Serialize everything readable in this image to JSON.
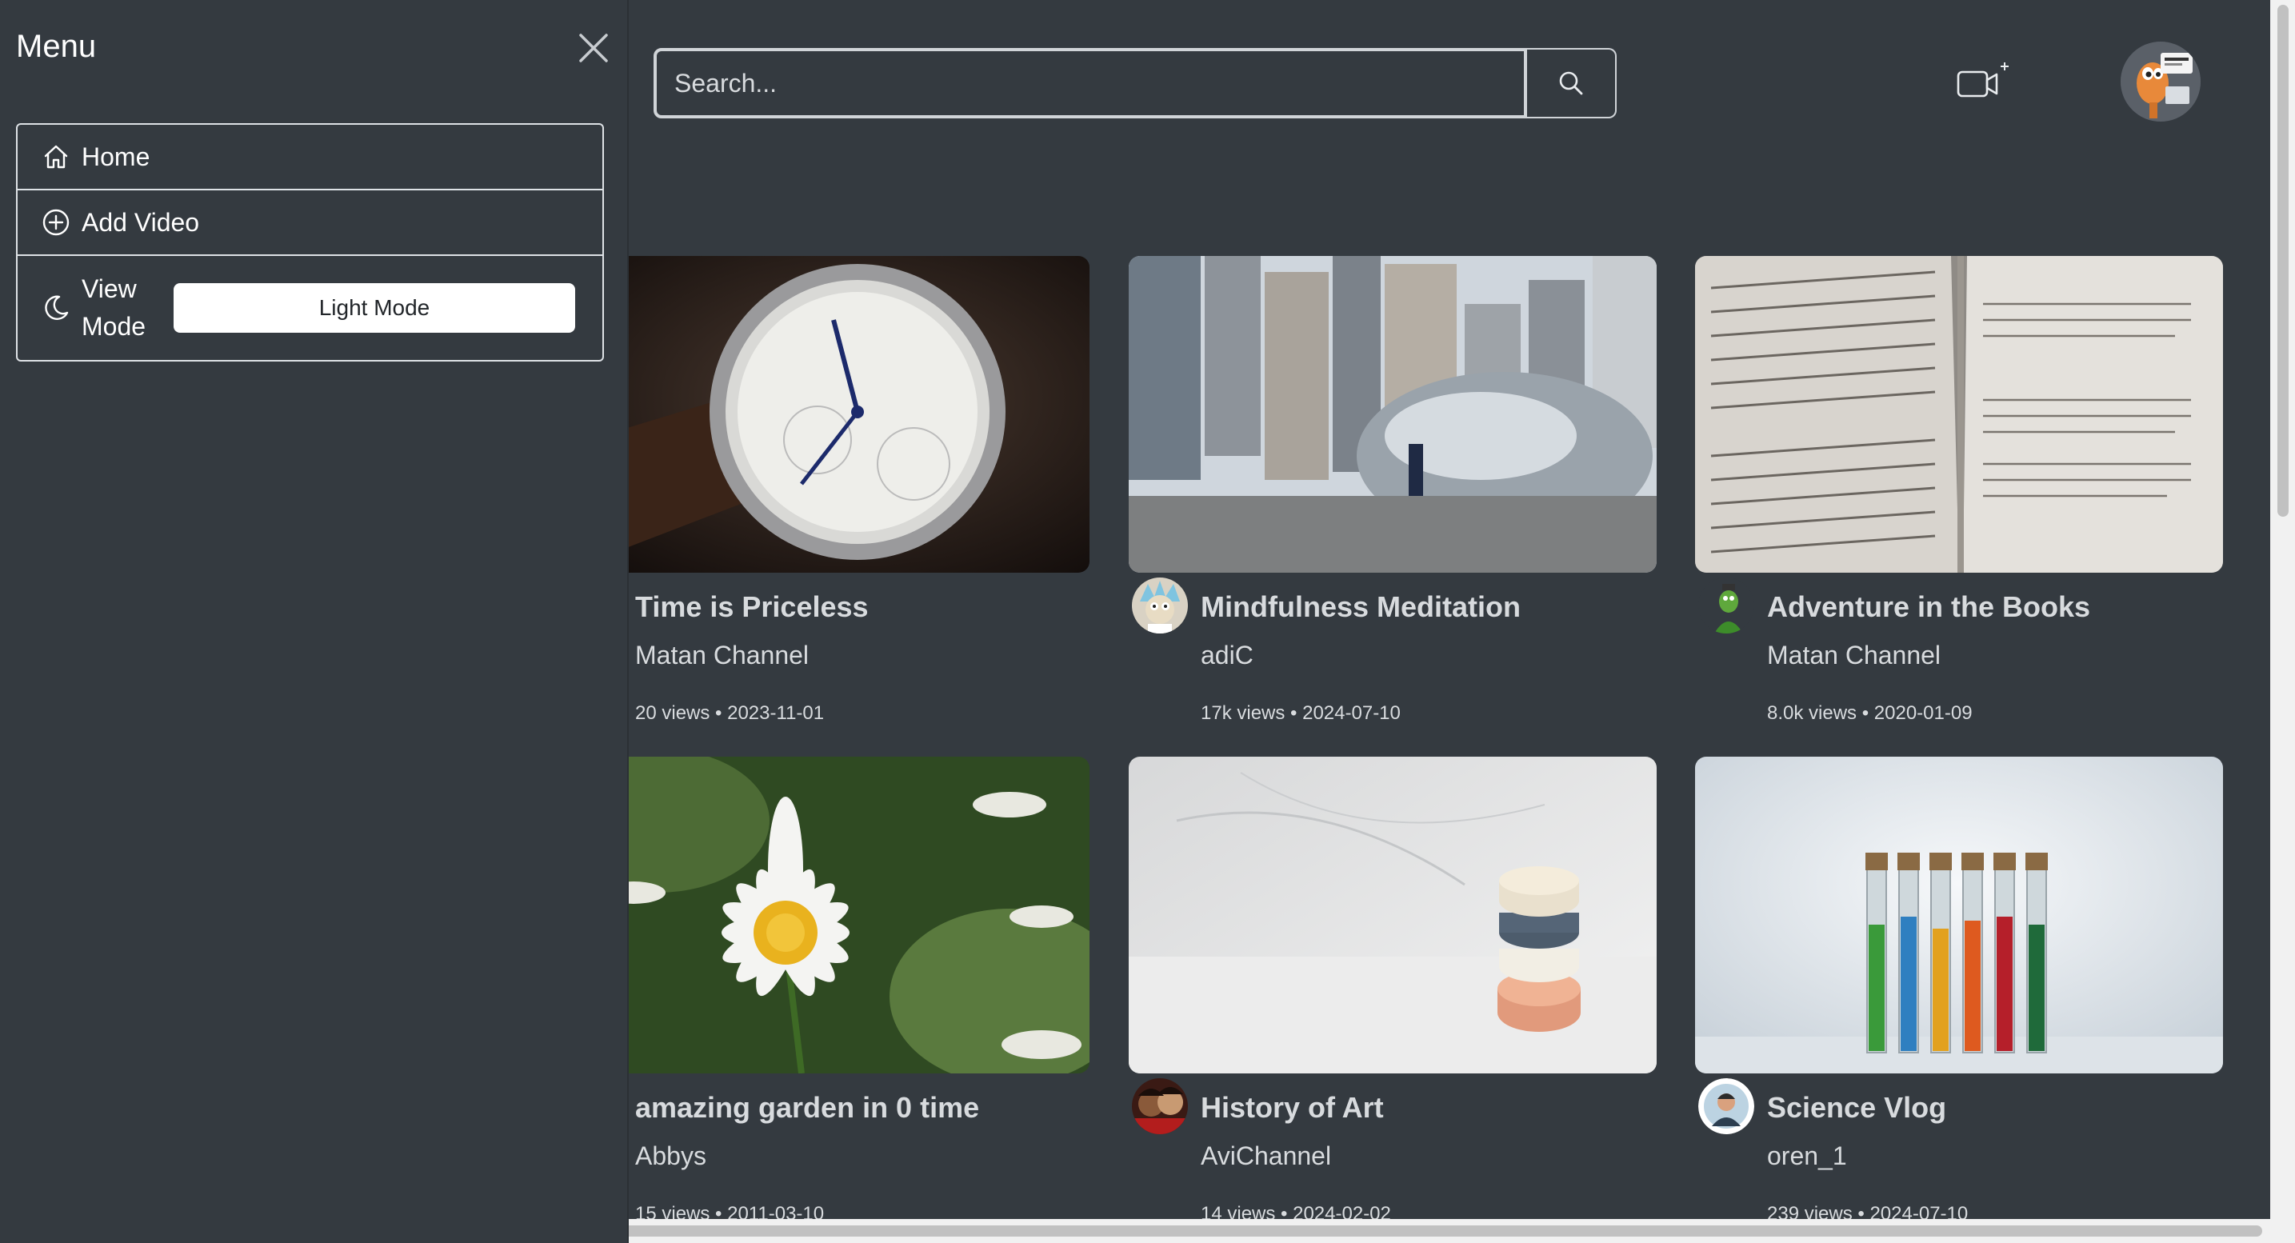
{
  "sidebar": {
    "title": "Menu",
    "items": [
      {
        "label": "Home",
        "icon": "home-icon"
      },
      {
        "label": "Add Video",
        "icon": "plus-circle-icon"
      }
    ],
    "view_mode": {
      "label": "View Mode",
      "button_label": "Light Mode",
      "icon": "moon-icon"
    }
  },
  "search": {
    "placeholder": "Search...",
    "value": ""
  },
  "header": {
    "upload_icon": "video-camera-plus-icon",
    "avatar_icon": "user-avatar-icon"
  },
  "videos": [
    {
      "title": "Time is Priceless",
      "channel": "Matan Channel",
      "meta": "20 views • 2023-11-01",
      "thumb": "watch"
    },
    {
      "title": "Mindfulness Meditation",
      "channel": "adiC",
      "meta": "17k views • 2024-07-10",
      "thumb": "city"
    },
    {
      "title": "Adventure in the Books",
      "channel": "Matan Channel",
      "meta": "8.0k views • 2020-01-09",
      "thumb": "book"
    },
    {
      "title": "amazing garden in 0 time",
      "channel": "Abbys",
      "meta": "15 views • 2011-03-10",
      "thumb": "daisy"
    },
    {
      "title": "History of Art",
      "channel": "AviChannel",
      "meta": "14 views • 2024-02-02",
      "thumb": "stones"
    },
    {
      "title": "Science Vlog",
      "channel": "oren_1",
      "meta": "239 views • 2024-07-10",
      "thumb": "tubes"
    }
  ],
  "colors": {
    "background": "#343a40",
    "text": "#d8dbde",
    "button_light": "#ffffff"
  }
}
